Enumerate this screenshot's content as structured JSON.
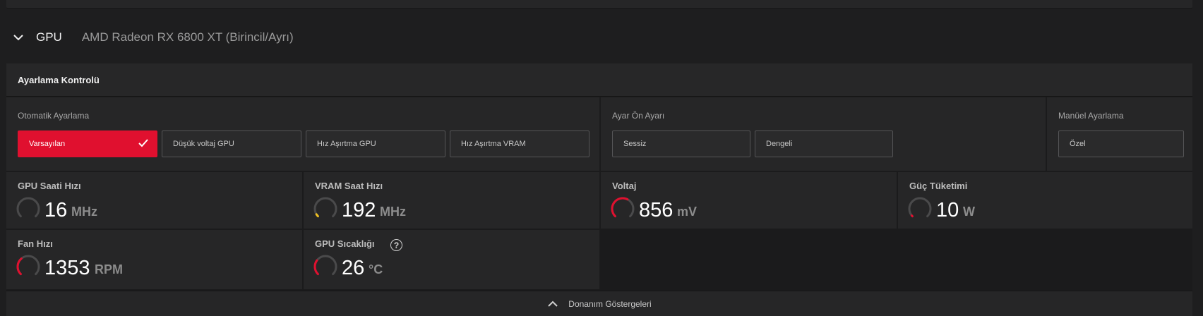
{
  "gpu": {
    "title": "GPU",
    "model": "AMD Radeon RX 6800 XT (Birincil/Ayrı)"
  },
  "tuning": {
    "panel_title": "Ayarlama Kontrolü",
    "auto": {
      "label": "Otomatik Ayarlama",
      "options": [
        "Varsayılan",
        "Düşük voltaj GPU",
        "Hız Aşırtma GPU",
        "Hız Aşırtma VRAM"
      ],
      "selected": "Varsayılan"
    },
    "preset": {
      "label": "Ayar Ön Ayarı",
      "options": [
        "Sessiz",
        "Dengeli"
      ]
    },
    "manual": {
      "label": "Manüel Ayarlama",
      "options": [
        "Özel"
      ]
    }
  },
  "metrics": [
    {
      "title": "GPU Saati Hızı",
      "value": "16",
      "unit": "MHz",
      "level": 0.0,
      "color": "#555555"
    },
    {
      "title": "VRAM Saat Hızı",
      "value": "192",
      "unit": "MHz",
      "level": 0.05,
      "color": "#f0c020"
    },
    {
      "title": "Voltaj",
      "value": "856",
      "unit": "mV",
      "level": 0.6,
      "color": "#e0102f"
    },
    {
      "title": "Güç Tüketimi",
      "value": "10",
      "unit": "W",
      "level": 0.02,
      "color": "#e0102f"
    },
    {
      "title": "Fan Hızı",
      "value": "1353",
      "unit": "RPM",
      "level": 0.35,
      "color": "#e0102f"
    },
    {
      "title": "GPU Sıcaklığı",
      "value": "26",
      "unit": "°C",
      "level": 0.3,
      "color": "#e0102f"
    }
  ],
  "footer": {
    "label": "Donanım Göstergeleri"
  },
  "colors": {
    "accent": "#e0102f",
    "panel": "#262627",
    "background": "#1e1e1f"
  }
}
